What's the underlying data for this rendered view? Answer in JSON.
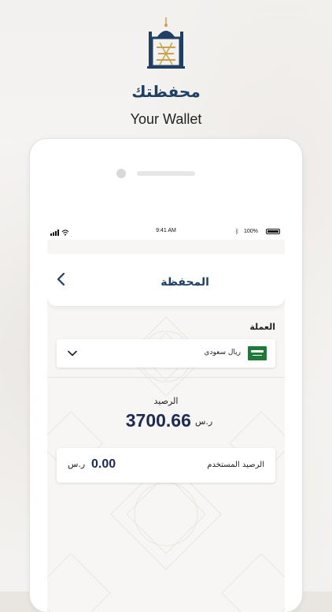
{
  "branding": {
    "logo_icon": "mosque-logo-icon",
    "title_ar": "محفظتك",
    "title_en": "Your Wallet"
  },
  "status_bar": {
    "time": "9:41 AM",
    "battery_percent": "100%",
    "icons": [
      "signal-icon",
      "wifi-icon",
      "bluetooth-icon",
      "battery-icon"
    ]
  },
  "navbar": {
    "title": "المحفظة",
    "back_icon": "chevron-left-icon"
  },
  "currency": {
    "label": "العملة",
    "selected": "ريال سعودي",
    "flag_icon": "saudi-flag-icon",
    "dropdown_icon": "chevron-down-icon"
  },
  "balance": {
    "label": "الرصيد",
    "value": "3700.66",
    "unit": "ر.س"
  },
  "used_balance": {
    "label": "الرصيد المستخدم",
    "value": "0.00",
    "unit": "ر.س"
  },
  "colors": {
    "primary": "#1f3f64",
    "amount": "#1c2b52",
    "gold": "#c9a24a",
    "flag_green": "#1f7a3a"
  }
}
